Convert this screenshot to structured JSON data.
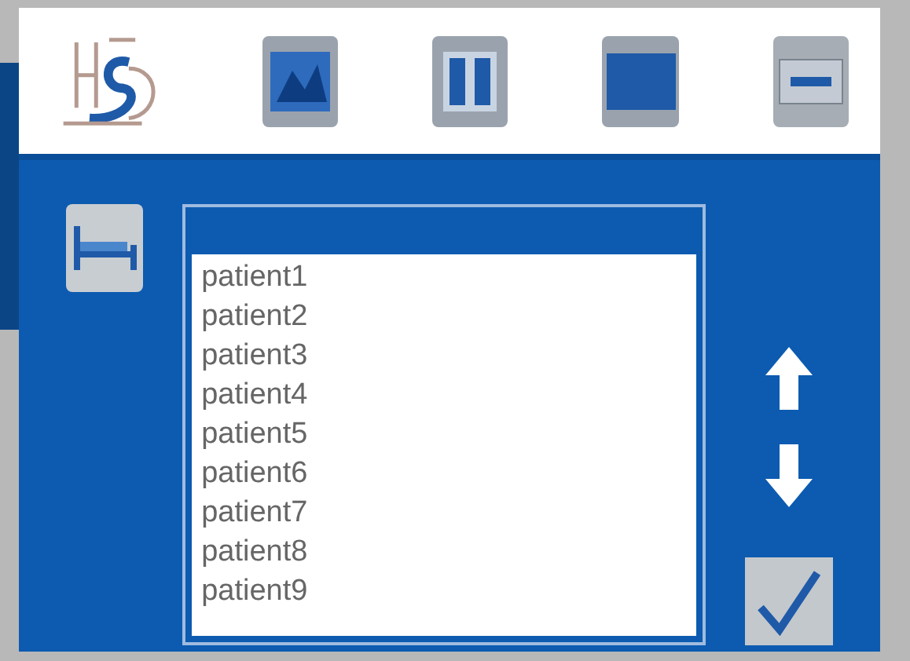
{
  "patients": [
    {
      "label": "patient1",
      "selected": false
    },
    {
      "label": "patient2",
      "selected": false
    },
    {
      "label": "patient3",
      "selected": false
    },
    {
      "label": "patient4",
      "selected": false
    },
    {
      "label": "patient5",
      "selected": false
    },
    {
      "label": "patient6",
      "selected": false
    },
    {
      "label": "patient7",
      "selected": false
    },
    {
      "label": "patient8",
      "selected": false
    },
    {
      "label": "patient9",
      "selected": false
    }
  ]
}
